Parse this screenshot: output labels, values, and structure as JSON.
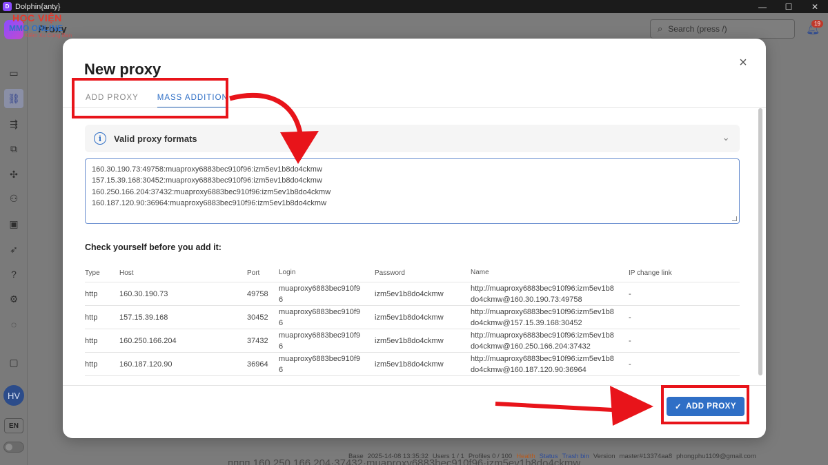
{
  "window": {
    "title": "Dolphin{anty}",
    "minimize": "—",
    "maximize": "☐",
    "close": "✕"
  },
  "watermark": {
    "line1": "HỌC VIỆN",
    "line2": "MMO ONLINE",
    "line3": "Kiếm Xu Cùng Bạn"
  },
  "app": {
    "page_title": "Proxy",
    "search_placeholder": "Search (press /)",
    "notification_count": "19",
    "avatar_initials": "HV",
    "language": "EN"
  },
  "statusbar": {
    "base": "Base",
    "date": "2025-14-08 13:35:32",
    "users": "Users 1 / 1",
    "profiles": "Profiles 0 / 100",
    "health": "Health",
    "status": "Status",
    "trash": "Trash bin",
    "version": "Version",
    "build": "master#13374aa8",
    "email": "phongphu1109@gmail.com"
  },
  "behind_text": "пппп 160 250 166 204·37432·muaproxy6883bec910f96·izm5ev1b8do4ckmw",
  "modal": {
    "title": "New proxy",
    "close": "×",
    "tabs": [
      {
        "label": "ADD PROXY",
        "active": false
      },
      {
        "label": "MASS ADDITION",
        "active": true
      }
    ],
    "accordion_title": "Valid proxy formats",
    "textarea_lines": [
      "160.30.190.73:49758:muaproxy6883bec910f96:izm5ev1b8do4ckmw",
      "157.15.39.168:30452:muaproxy6883bec910f96:izm5ev1b8do4ckmw",
      "160.250.166.204:37432:muaproxy6883bec910f96:izm5ev1b8do4ckmw",
      "160.187.120.90:36964:muaproxy6883bec910f96:izm5ev1b8do4ckmw"
    ],
    "check_title": "Check yourself before you add it:",
    "table": {
      "headers": [
        "Type",
        "Host",
        "Port",
        "Login",
        "Password",
        "Name",
        "IP change link"
      ],
      "rows": [
        {
          "type": "http",
          "host": "160.30.190.73",
          "port": "49758",
          "login1": "muaproxy6883bec910f9",
          "login2": "6",
          "password": "izm5ev1b8do4ckmw",
          "name1": "http://muaproxy6883bec910f96:izm5ev1b8",
          "name2": "do4ckmw@160.30.190.73:49758",
          "ip": "-"
        },
        {
          "type": "http",
          "host": "157.15.39.168",
          "port": "30452",
          "login1": "muaproxy6883bec910f9",
          "login2": "6",
          "password": "izm5ev1b8do4ckmw",
          "name1": "http://muaproxy6883bec910f96:izm5ev1b8",
          "name2": "do4ckmw@157.15.39.168:30452",
          "ip": "-"
        },
        {
          "type": "http",
          "host": "160.250.166.204",
          "port": "37432",
          "login1": "muaproxy6883bec910f9",
          "login2": "6",
          "password": "izm5ev1b8do4ckmw",
          "name1": "http://muaproxy6883bec910f96:izm5ev1b8",
          "name2": "do4ckmw@160.250.166.204:37432",
          "ip": "-"
        },
        {
          "type": "http",
          "host": "160.187.120.90",
          "port": "36964",
          "login1": "muaproxy6883bec910f9",
          "login2": "6",
          "password": "izm5ev1b8do4ckmw",
          "name1": "http://muaproxy6883bec910f96:izm5ev1b8",
          "name2": "do4ckmw@160.187.120.90:36964",
          "ip": "-"
        }
      ]
    },
    "submit_label": "ADD PROXY",
    "submit_icon": "✓"
  },
  "colors": {
    "accent": "#2f6fc6",
    "annotation": "#e8141a"
  }
}
